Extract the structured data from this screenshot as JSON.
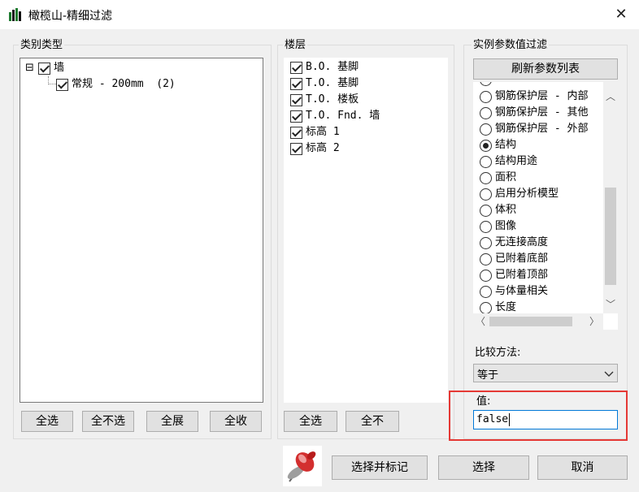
{
  "window": {
    "title": "橄榄山-精细过滤",
    "close_icon": "close-icon"
  },
  "category": {
    "label": "类别类型",
    "tree": {
      "expander": "⊟",
      "root_label": "墙",
      "child_label": "常规 - 200mm  (2)"
    },
    "buttons": {
      "select_all": "全选",
      "select_none": "全不选",
      "expand_all": "全展",
      "collapse_all": "全收"
    }
  },
  "floors": {
    "label": "楼层",
    "items": [
      "B.O. 基脚",
      "T.O. 基脚",
      "T.O. 楼板",
      "T.O. Fnd. 墙",
      "标高 1",
      "标高 2"
    ],
    "buttons": {
      "select_all": "全选",
      "select_none": "全不"
    }
  },
  "params": {
    "label": "实例参数值过滤",
    "refresh_button": "刷新参数列表",
    "items": [
      {
        "label": "钢筋保护层 - 内部",
        "selected": false
      },
      {
        "label": "钢筋保护层 - 其他",
        "selected": false
      },
      {
        "label": "钢筋保护层 - 外部",
        "selected": false
      },
      {
        "label": "结构",
        "selected": true
      },
      {
        "label": "结构用途",
        "selected": false
      },
      {
        "label": "面积",
        "selected": false
      },
      {
        "label": "启用分析模型",
        "selected": false
      },
      {
        "label": "体积",
        "selected": false
      },
      {
        "label": "图像",
        "selected": false
      },
      {
        "label": "无连接高度",
        "selected": false
      },
      {
        "label": "已附着底部",
        "selected": false
      },
      {
        "label": "已附着顶部",
        "selected": false
      },
      {
        "label": "与体量相关",
        "selected": false
      },
      {
        "label": "长度",
        "selected": false
      }
    ],
    "compare_label": "比较方法:",
    "compare_value": "等于",
    "value_label": "值:",
    "value_input": "false"
  },
  "footer": {
    "pin_icon": "pushpin-icon",
    "select_mark_button": "选择并标记",
    "select_button": "选择",
    "cancel_button": "取消"
  },
  "colors": {
    "highlight_box": "#e53935",
    "input_focus": "#0078d7"
  }
}
